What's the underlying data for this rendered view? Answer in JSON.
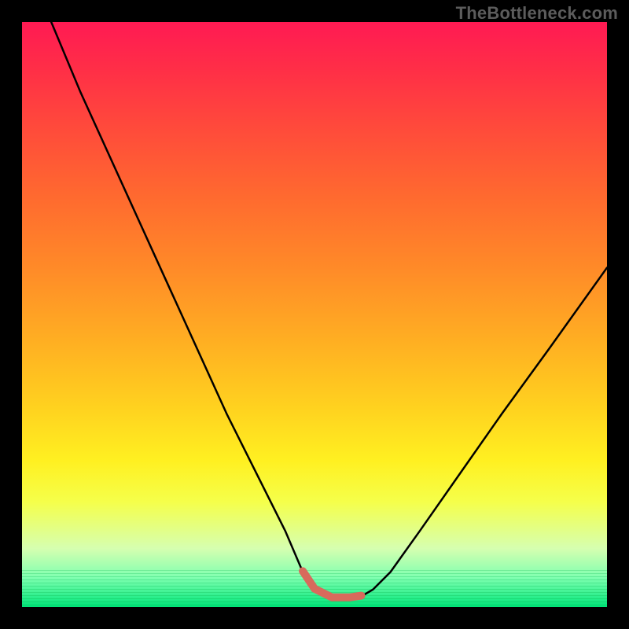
{
  "watermark": "TheBottleneck.com",
  "chart_data": {
    "type": "line",
    "title": "",
    "xlabel": "",
    "ylabel": "",
    "xlim": [
      0,
      100
    ],
    "ylim": [
      0,
      100
    ],
    "grid": false,
    "series": [
      {
        "name": "bottleneck-curve",
        "x": [
          5,
          10,
          15,
          20,
          25,
          30,
          35,
          40,
          45,
          48,
          50,
          53,
          56,
          58,
          60,
          63,
          68,
          75,
          82,
          90,
          100
        ],
        "y": [
          100,
          88,
          77,
          66,
          55,
          44,
          33,
          23,
          13,
          6,
          3,
          1.5,
          1.5,
          1.8,
          3,
          6,
          13,
          23,
          33,
          44,
          58
        ]
      }
    ],
    "highlight": {
      "name": "optimal-zone",
      "x_range": [
        48,
        58
      ],
      "color": "#d86a5c"
    },
    "gradient_meaning": "red=high bottleneck, green=low bottleneck"
  }
}
